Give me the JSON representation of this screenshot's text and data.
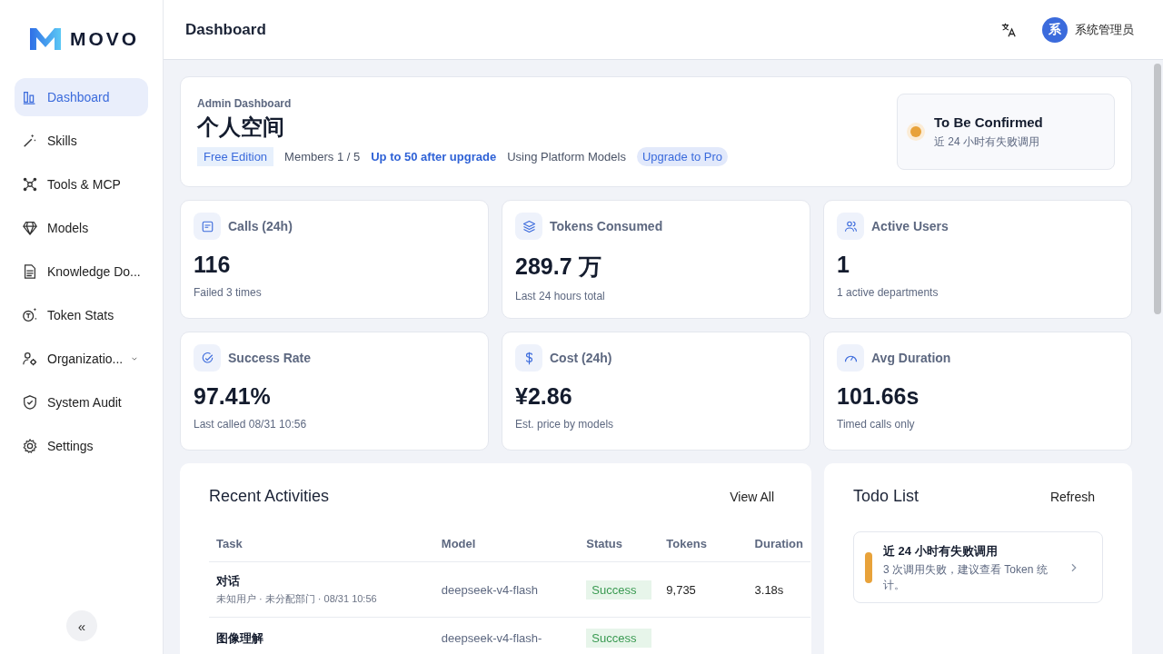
{
  "brand": {
    "name": "MOVO"
  },
  "sidebar": {
    "items": [
      {
        "label": "Dashboard",
        "selected": true,
        "kind": "link"
      },
      {
        "label": "Skills",
        "selected": false,
        "kind": "link"
      },
      {
        "label": "Tools & MCP",
        "selected": false,
        "kind": "link"
      },
      {
        "label": "Models",
        "selected": false,
        "kind": "link"
      },
      {
        "label": "Knowledge Do...",
        "selected": false,
        "kind": "link"
      },
      {
        "label": "Token Stats",
        "selected": false,
        "kind": "link"
      },
      {
        "label": "Organizatio...",
        "selected": false,
        "kind": "group",
        "expanded": false
      },
      {
        "label": "System Audit",
        "selected": false,
        "kind": "link"
      },
      {
        "label": "Settings",
        "selected": false,
        "kind": "link"
      }
    ],
    "collapse": "«"
  },
  "header": {
    "title": "Dashboard",
    "user": {
      "initial": "系",
      "name": "系统管理员"
    }
  },
  "workspace": {
    "eyebrow": "Admin Dashboard",
    "name": "个人空间",
    "edition": "Free Edition",
    "members": "Members 1 / 5",
    "upgrade_note": "Up to 50 after upgrade",
    "models": "Using Platform Models",
    "upgrade_button": "Upgrade to Pro",
    "alert": {
      "title": "To Be Confirmed",
      "text": "近 24 小时有失败调用",
      "color": "#e8a23a"
    }
  },
  "stats": [
    {
      "label": "Calls (24h)",
      "value": "116",
      "note": "Failed 3 times"
    },
    {
      "label": "Tokens Consumed",
      "value": "289.7 万",
      "note": "Last 24 hours total"
    },
    {
      "label": "Active Users",
      "value": "1",
      "note": "1 active departments"
    },
    {
      "label": "Success Rate",
      "value": "97.41%",
      "note": "Last called 08/31 10:56"
    },
    {
      "label": "Cost (24h)",
      "value": "¥2.86",
      "note": "Est. price by models"
    },
    {
      "label": "Avg Duration",
      "value": "101.66s",
      "note": "Timed calls only"
    }
  ],
  "recent": {
    "title": "Recent Activities",
    "link": "View All",
    "table": {
      "columns": [
        "Task",
        "Model",
        "Status",
        "Tokens",
        "Duration"
      ],
      "rows": [
        {
          "task": "对话",
          "meta": "未知用户 · 未分配部门 · 08/31 10:56",
          "model": "deepseek-v4-flash",
          "status": "Success",
          "tokens": "9,735",
          "duration": "3.18s"
        },
        {
          "task": "图像理解",
          "model": "deepseek-v4-flash-",
          "status": "Success"
        }
      ]
    }
  },
  "todo": {
    "title": "Todo List",
    "link": "Refresh",
    "items": [
      {
        "title": "近 24 小时有失败调用",
        "text": "3 次调用失败，建议查看 Token 统计。",
        "color": "#e8a23a"
      }
    ]
  }
}
